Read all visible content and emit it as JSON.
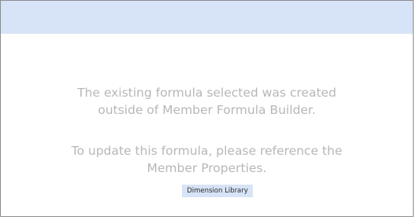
{
  "messages": {
    "line1": "The existing formula selected was created",
    "line2": "outside of Member Formula Builder.",
    "line3": "To update this formula, please reference the",
    "line4": "Member Properties."
  },
  "actions": {
    "dimension_library_label": "Dimension Library"
  },
  "colors": {
    "header_bar": "#d7e3f6",
    "message_text": "#b7b7b7",
    "button_bg": "#d7e3f6"
  }
}
